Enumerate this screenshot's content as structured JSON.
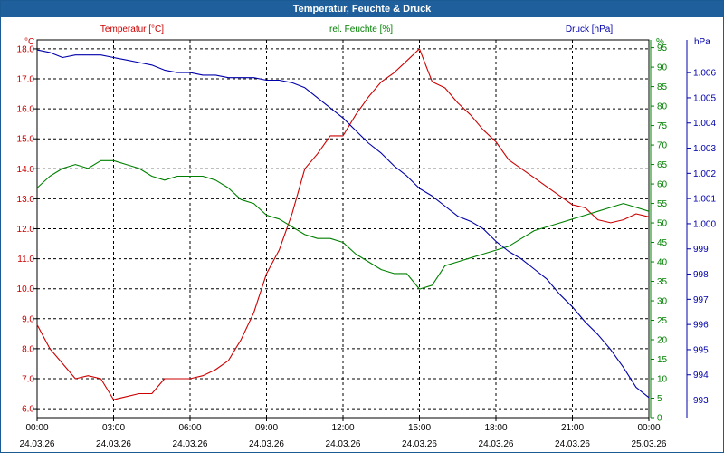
{
  "window": {
    "title": "Temperatur, Feuchte & Druck"
  },
  "colors": {
    "temperature": "#cc0000",
    "humidity": "#008000",
    "pressure": "#0000aa",
    "titlebar": "#1f5f9c",
    "grid": "#000000",
    "text": "#000000"
  },
  "chart_data": {
    "type": "line",
    "title": "",
    "grid": true,
    "x_tick_times": [
      "00:00",
      "03:00",
      "06:00",
      "09:00",
      "12:00",
      "15:00",
      "18:00",
      "21:00",
      "00:00"
    ],
    "x_tick_dates": [
      "24.03.26",
      "24.03.26",
      "24.03.26",
      "24.03.26",
      "24.03.26",
      "24.03.26",
      "24.03.26",
      "24.03.26",
      "25.03.26"
    ],
    "x_hours": [
      0,
      0.5,
      1,
      1.5,
      2,
      2.5,
      3,
      3.5,
      4,
      4.5,
      5,
      5.5,
      6,
      6.5,
      7,
      7.5,
      8,
      8.5,
      9,
      9.5,
      10,
      10.5,
      11,
      11.5,
      12,
      12.5,
      13,
      13.5,
      14,
      14.5,
      15,
      15.5,
      16,
      16.5,
      17,
      17.5,
      18,
      18.5,
      19,
      19.5,
      20,
      20.5,
      21,
      21.5,
      22,
      22.5,
      23,
      23.5,
      24
    ],
    "axes": [
      {
        "id": "temperature",
        "label": "Temperatur [°C]",
        "unit": "°C",
        "side": "left",
        "range": [
          5.7,
          18.3
        ],
        "ticks": [
          "6.0",
          "7.0",
          "8.0",
          "9.0",
          "10.0",
          "11.0",
          "12.0",
          "13.0",
          "14.0",
          "15.0",
          "16.0",
          "17.0",
          "18.0"
        ]
      },
      {
        "id": "humidity",
        "label": "rel. Feuchte [%]",
        "unit": "%",
        "side": "right-inner",
        "range": [
          0,
          97
        ],
        "ticks": [
          "0",
          "5",
          "10",
          "15",
          "20",
          "25",
          "30",
          "35",
          "40",
          "45",
          "50",
          "55",
          "60",
          "65",
          "70",
          "75",
          "80",
          "85",
          "90",
          "95"
        ]
      },
      {
        "id": "pressure",
        "label": "Druck [hPa]",
        "unit": "hPa",
        "side": "right-outer",
        "range": [
          992.3,
          1007.3
        ],
        "ticks": [
          "993",
          "994",
          "995",
          "996",
          "997",
          "998",
          "999",
          "1.000",
          "1.001",
          "1.002",
          "1.003",
          "1.004",
          "1.005",
          "1.006"
        ]
      }
    ],
    "series": [
      {
        "name": "Temperatur [°C]",
        "axis": "temperature",
        "values": [
          8.8,
          8.0,
          7.5,
          7.0,
          7.1,
          7.0,
          6.3,
          6.4,
          6.5,
          6.5,
          7.0,
          7.0,
          7.0,
          7.1,
          7.3,
          7.6,
          8.3,
          9.2,
          10.5,
          11.3,
          12.5,
          14.0,
          14.5,
          15.1,
          15.1,
          15.8,
          16.4,
          16.9,
          17.2,
          17.6,
          18.0,
          16.9,
          16.7,
          16.2,
          15.8,
          15.3,
          14.9,
          14.3,
          14.0,
          13.7,
          13.4,
          13.1,
          12.8,
          12.7,
          12.3,
          12.2,
          12.3,
          12.5,
          12.4
        ]
      },
      {
        "name": "rel. Feuchte [%]",
        "axis": "humidity",
        "values": [
          59,
          62,
          64,
          65,
          64,
          66,
          66,
          65,
          64,
          62,
          61,
          62,
          62,
          62,
          61,
          59,
          56,
          55,
          52,
          51,
          49,
          47,
          46,
          46,
          45,
          42,
          40,
          38,
          37,
          37,
          33,
          34,
          39,
          40,
          41,
          42,
          43,
          44,
          46,
          48,
          49,
          50,
          51,
          52,
          53,
          54,
          55,
          54,
          53
        ]
      },
      {
        "name": "Druck [hPa]",
        "axis": "pressure",
        "values": [
          1006.9,
          1006.8,
          1006.6,
          1006.7,
          1006.7,
          1006.7,
          1006.6,
          1006.5,
          1006.4,
          1006.3,
          1006.1,
          1006.0,
          1006.0,
          1005.9,
          1005.9,
          1005.8,
          1005.8,
          1005.8,
          1005.7,
          1005.7,
          1005.6,
          1005.4,
          1005.0,
          1004.6,
          1004.2,
          1003.7,
          1003.2,
          1002.8,
          1002.3,
          1001.9,
          1001.4,
          1001.1,
          1000.7,
          1000.3,
          1000.1,
          999.8,
          999.3,
          998.9,
          998.6,
          998.2,
          997.8,
          997.2,
          996.7,
          996.1,
          995.6,
          995.0,
          994.3,
          993.5,
          993.1
        ]
      }
    ]
  }
}
